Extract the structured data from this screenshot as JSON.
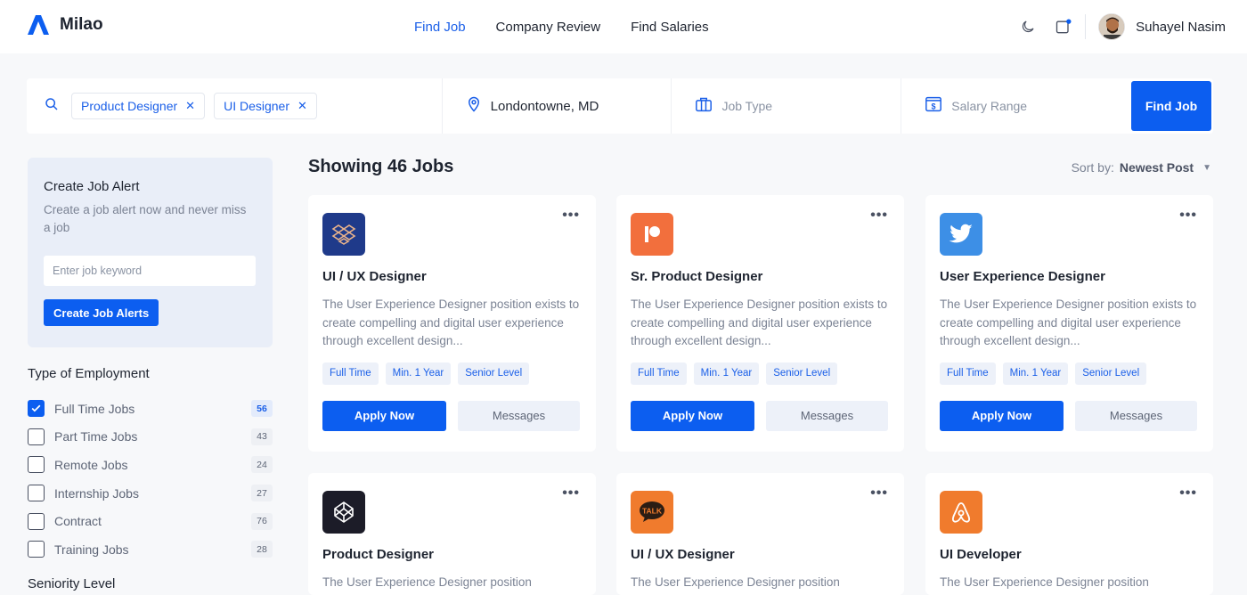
{
  "header": {
    "brand": "Milao",
    "nav": [
      {
        "label": "Find Job",
        "active": true
      },
      {
        "label": "Company Review",
        "active": false
      },
      {
        "label": "Find Salaries",
        "active": false
      }
    ],
    "user_name": "Suhayel Nasim"
  },
  "search": {
    "keywords": [
      "Product Designer",
      "UI Designer"
    ],
    "location": "Londontowne, MD",
    "job_type_placeholder": "Job Type",
    "salary_placeholder": "Salary Range",
    "button": "Find Job"
  },
  "sidebar": {
    "alert": {
      "title": "Create Job Alert",
      "description": "Create a job alert now and never miss a job",
      "input_placeholder": "Enter job keyword",
      "button": "Create Job Alerts"
    },
    "employment_title": "Type of Employment",
    "employment": [
      {
        "label": "Full Time Jobs",
        "count": "56",
        "checked": true
      },
      {
        "label": "Part Time Jobs",
        "count": "43",
        "checked": false
      },
      {
        "label": "Remote Jobs",
        "count": "24",
        "checked": false
      },
      {
        "label": "Internship Jobs",
        "count": "27",
        "checked": false
      },
      {
        "label": "Contract",
        "count": "76",
        "checked": false
      },
      {
        "label": "Training Jobs",
        "count": "28",
        "checked": false
      }
    ],
    "seniority_title": "Seniority Level"
  },
  "main": {
    "showing": "Showing 46 Jobs",
    "sort_label": "Sort by:",
    "sort_value": "Newest Post",
    "jobs": [
      {
        "title": "UI / UX Designer",
        "logo": "dropbox-logo",
        "desc": "The User Experience Designer position exists to create compelling and digital user experience through excellent design...",
        "tags": [
          "Full Time",
          "Min. 1 Year",
          "Senior Level"
        ],
        "apply": "Apply Now",
        "messages": "Messages"
      },
      {
        "title": "Sr. Product Designer",
        "logo": "patreon-logo",
        "desc": "The User Experience Designer position exists to create compelling and digital user experience through excellent design...",
        "tags": [
          "Full Time",
          "Min. 1 Year",
          "Senior Level"
        ],
        "apply": "Apply Now",
        "messages": "Messages"
      },
      {
        "title": "User Experience Designer",
        "logo": "twitter-logo",
        "desc": "The User Experience Designer position exists to create compelling and digital user experience through excellent design...",
        "tags": [
          "Full Time",
          "Min. 1 Year",
          "Senior Level"
        ],
        "apply": "Apply Now",
        "messages": "Messages"
      },
      {
        "title": "Product Designer",
        "logo": "codepen-logo",
        "desc": "The User Experience Designer position"
      },
      {
        "title": "UI / UX Designer",
        "logo": "kakaotalk-logo",
        "logo_text": "TALK",
        "desc": "The User Experience Designer position"
      },
      {
        "title": "UI Developer",
        "logo": "airbnb-logo",
        "desc": "The User Experience Designer position"
      }
    ]
  },
  "colors": {
    "accent": "#0c5ef0",
    "dropbox": "#1f3a8a",
    "patreon": "#f26f3d",
    "twitter": "#3d8fe6",
    "codepen": "#1c1c28",
    "kakaotalk": "#f07b2d",
    "airbnb": "#f07b2d"
  }
}
